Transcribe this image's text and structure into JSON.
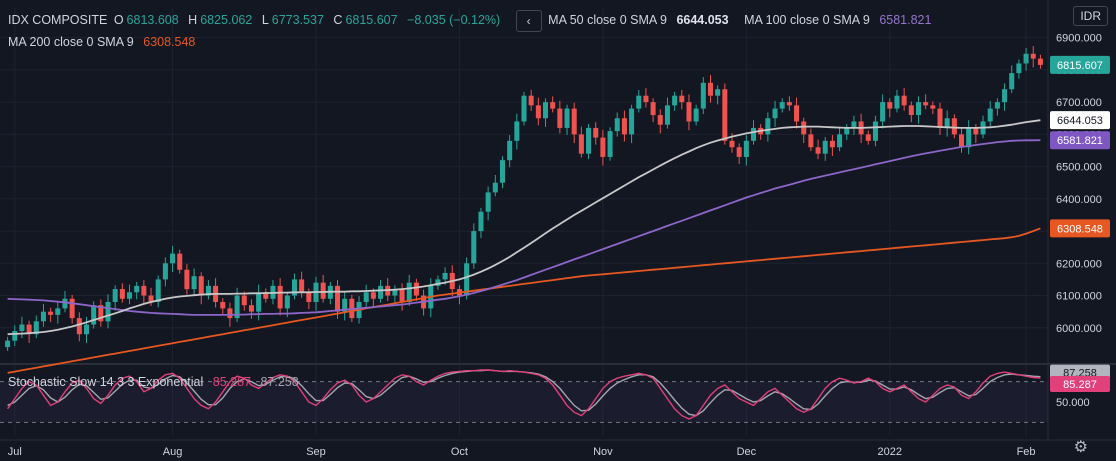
{
  "header": {
    "symbol": "IDX COMPOSITE",
    "o_label": "O",
    "o_value": "6813.608",
    "h_label": "H",
    "h_value": "6825.062",
    "l_label": "L",
    "l_value": "6773.537",
    "c_label": "C",
    "c_value": "6815.607",
    "change": "−8.035 (−0.12%)",
    "collapse_icon": "chevron-left-icon",
    "ma50_label": "MA 50 close 0 SMA 9",
    "ma50_value": "6644.053",
    "ma100_label": "MA 100 close 0 SMA 9",
    "ma100_value": "6581.821",
    "ma200_label": "MA 200 close 0 SMA 9",
    "ma200_value": "6308.548",
    "currency": "IDR"
  },
  "stoch_header": {
    "label": "Stochastic Slow 14 3 3 Exponential",
    "k_value": "85.287",
    "d_value": "87.258"
  },
  "colors": {
    "background": "#131722",
    "up": "#26a69a",
    "down": "#ef5350",
    "ma50": "#c8c8c8",
    "ma100": "#8e65c9",
    "ma200": "#e65722",
    "stoch_k": "#e2407a",
    "stoch_d": "#a3a6af",
    "grid": "#1e2230"
  },
  "chart_data": {
    "type": "candlestick",
    "y_ticks": [
      6000,
      6100,
      6200,
      6300,
      6400,
      6500,
      6600,
      6700,
      6800,
      6900
    ],
    "y_tick_labels": [
      "6000.000",
      "6100.000",
      "6200.000",
      "6300.000",
      "6400.000",
      "6500.000",
      "6600.000",
      "6700.000",
      "6800.000",
      "6900.000"
    ],
    "ylim": [
      5900,
      6930
    ],
    "x_tick_labels": [
      "Jul",
      "Aug",
      "Sep",
      "Oct",
      "Nov",
      "Dec",
      "2022",
      "Feb"
    ],
    "x_tick_index": [
      1,
      23,
      43,
      63,
      83,
      103,
      123,
      142
    ],
    "price_badges": [
      {
        "label": "6815.607",
        "value": 6815.607,
        "series": "price"
      },
      {
        "label": "6644.053",
        "value": 6644.053,
        "series": "ma50"
      },
      {
        "label": "6581.821",
        "value": 6581.821,
        "series": "ma100"
      },
      {
        "label": "6308.548",
        "value": 6308.548,
        "series": "ma200"
      }
    ],
    "closes": [
      5960,
      5990,
      6010,
      5980,
      6020,
      6050,
      6040,
      6060,
      6090,
      6030,
      5980,
      6010,
      6070,
      6020,
      6080,
      6120,
      6090,
      6110,
      6130,
      6100,
      6080,
      6150,
      6200,
      6230,
      6180,
      6120,
      6160,
      6100,
      6130,
      6080,
      6060,
      6030,
      6100,
      6070,
      6050,
      6110,
      6090,
      6130,
      6060,
      6100,
      6150,
      6110,
      6080,
      6140,
      6090,
      6130,
      6050,
      6090,
      6030,
      6080,
      6110,
      6090,
      6130,
      6100,
      6120,
      6080,
      6140,
      6100,
      6060,
      6130,
      6150,
      6170,
      6120,
      6100,
      6200,
      6300,
      6360,
      6420,
      6450,
      6520,
      6580,
      6640,
      6720,
      6690,
      6650,
      6700,
      6680,
      6620,
      6680,
      6600,
      6540,
      6620,
      6590,
      6530,
      6610,
      6650,
      6600,
      6680,
      6720,
      6700,
      6660,
      6630,
      6690,
      6720,
      6700,
      6640,
      6680,
      6760,
      6720,
      6740,
      6580,
      6560,
      6530,
      6580,
      6620,
      6600,
      6650,
      6680,
      6700,
      6690,
      6640,
      6600,
      6560,
      6540,
      6580,
      6560,
      6600,
      6620,
      6640,
      6600,
      6580,
      6640,
      6700,
      6680,
      6720,
      6690,
      6660,
      6700,
      6690,
      6680,
      6620,
      6650,
      6600,
      6560,
      6620,
      6600,
      6640,
      6680,
      6700,
      6740,
      6790,
      6820,
      6850,
      6835,
      6815.607
    ],
    "ma50": [
      5980,
      5981,
      5982,
      5983,
      5985,
      5987,
      5990,
      5994,
      5999,
      6004,
      6010,
      6017,
      6024,
      6031,
      6038,
      6045,
      6052,
      6060,
      6067,
      6074,
      6080,
      6085,
      6090,
      6094,
      6097,
      6099,
      6101,
      6103,
      6104,
      6105,
      6105,
      6105,
      6106,
      6106,
      6107,
      6107,
      6108,
      6108,
      6109,
      6109,
      6110,
      6110,
      6110,
      6111,
      6111,
      6112,
      6112,
      6112,
      6113,
      6113,
      6114,
      6115,
      6116,
      6117,
      6118,
      6120,
      6122,
      6125,
      6128,
      6132,
      6136,
      6140,
      6145,
      6150,
      6157,
      6165,
      6174,
      6184,
      6195,
      6207,
      6220,
      6234,
      6248,
      6263,
      6278,
      6293,
      6308,
      6322,
      6336,
      6350,
      6363,
      6376,
      6389,
      6402,
      6415,
      6428,
      6441,
      6454,
      6467,
      6479,
      6491,
      6503,
      6515,
      6526,
      6537,
      6547,
      6557,
      6566,
      6574,
      6581,
      6587,
      6593,
      6598,
      6603,
      6607,
      6611,
      6614,
      6617,
      6620,
      6622,
      6623,
      6624,
      6624,
      6624,
      6623,
      6622,
      6621,
      6620,
      6620,
      6620,
      6621,
      6622,
      6623,
      6624,
      6625,
      6626,
      6626,
      6626,
      6625,
      6624,
      6623,
      6622,
      6621,
      6620,
      6620,
      6620,
      6621,
      6622,
      6624,
      6627,
      6630,
      6634,
      6638,
      6641,
      6644.053
    ],
    "ma100": [
      6090,
      6089,
      6088,
      6087,
      6086,
      6085,
      6083,
      6081,
      6079,
      6076,
      6073,
      6070,
      6067,
      6064,
      6061,
      6058,
      6055,
      6052,
      6050,
      6048,
      6046,
      6045,
      6044,
      6043,
      6042,
      6041,
      6040,
      6040,
      6040,
      6040,
      6040,
      6040,
      6041,
      6041,
      6042,
      6042,
      6043,
      6043,
      6044,
      6044,
      6045,
      6046,
      6047,
      6048,
      6050,
      6052,
      6054,
      6056,
      6058,
      6060,
      6062,
      6064,
      6066,
      6068,
      6070,
      6072,
      6075,
      6078,
      6081,
      6084,
      6087,
      6090,
      6094,
      6098,
      6103,
      6108,
      6114,
      6120,
      6127,
      6134,
      6141,
      6148,
      6156,
      6164,
      6172,
      6180,
      6188,
      6196,
      6204,
      6212,
      6220,
      6228,
      6236,
      6244,
      6252,
      6260,
      6268,
      6276,
      6284,
      6292,
      6300,
      6308,
      6316,
      6324,
      6332,
      6340,
      6348,
      6356,
      6364,
      6372,
      6380,
      6388,
      6396,
      6404,
      6411,
      6418,
      6425,
      6432,
      6438,
      6444,
      6450,
      6456,
      6462,
      6467,
      6472,
      6477,
      6482,
      6487,
      6492,
      6497,
      6502,
      6507,
      6512,
      6517,
      6522,
      6527,
      6532,
      6537,
      6541,
      6545,
      6549,
      6553,
      6557,
      6561,
      6564,
      6567,
      6570,
      6573,
      6576,
      6578,
      6580,
      6581,
      6581.5,
      6581.7,
      6581.821
    ],
    "ma200": [
      5860,
      5864,
      5868,
      5872,
      5876,
      5880,
      5884,
      5888,
      5892,
      5896,
      5900,
      5904,
      5908,
      5912,
      5916,
      5920,
      5924,
      5928,
      5932,
      5936,
      5940,
      5944,
      5948,
      5952,
      5956,
      5960,
      5964,
      5968,
      5972,
      5976,
      5980,
      5984,
      5988,
      5992,
      5996,
      6000,
      6004,
      6008,
      6012,
      6016,
      6020,
      6024,
      6028,
      6032,
      6036,
      6040,
      6044,
      6048,
      6052,
      6056,
      6060,
      6064,
      6068,
      6072,
      6076,
      6080,
      6084,
      6088,
      6092,
      6096,
      6100,
      6103,
      6106,
      6109,
      6112,
      6115,
      6118,
      6121,
      6124,
      6127,
      6130,
      6133,
      6136,
      6139,
      6142,
      6145,
      6148,
      6151,
      6154,
      6157,
      6160,
      6162,
      6164,
      6166,
      6168,
      6170,
      6172,
      6174,
      6176,
      6178,
      6180,
      6182,
      6184,
      6186,
      6188,
      6190,
      6192,
      6194,
      6196,
      6198,
      6200,
      6202,
      6204,
      6206,
      6208,
      6210,
      6212,
      6214,
      6216,
      6218,
      6220,
      6222,
      6224,
      6226,
      6228,
      6230,
      6232,
      6234,
      6236,
      6238,
      6240,
      6242,
      6244,
      6246,
      6248,
      6250,
      6252,
      6254,
      6256,
      6258,
      6260,
      6262,
      6264,
      6266,
      6268,
      6270,
      6272,
      6274,
      6276,
      6278,
      6281,
      6285,
      6292,
      6300,
      6308.548
    ],
    "stoch_ticks": [
      50
    ],
    "stoch_tick_labels": [
      "50.000"
    ],
    "stoch_levels": [
      80,
      20
    ],
    "stoch_badges": [
      {
        "label": "87.258",
        "value": 87.258,
        "series": "stoch_d"
      },
      {
        "label": "85.287",
        "value": 85.287,
        "series": "stoch_k"
      }
    ],
    "stoch_k": [
      40,
      55,
      70,
      80,
      75,
      60,
      45,
      50,
      65,
      78,
      82,
      70,
      55,
      48,
      60,
      75,
      85,
      88,
      80,
      65,
      70,
      82,
      90,
      92,
      85,
      70,
      55,
      45,
      40,
      50,
      65,
      80,
      88,
      85,
      75,
      70,
      78,
      86,
      90,
      88,
      80,
      65,
      50,
      45,
      55,
      68,
      78,
      82,
      75,
      60,
      50,
      55,
      65,
      75,
      85,
      90,
      88,
      80,
      75,
      82,
      88,
      92,
      94,
      95,
      96,
      96,
      97,
      97,
      96,
      95,
      96,
      95,
      94,
      92,
      90,
      85,
      75,
      60,
      45,
      35,
      30,
      40,
      55,
      70,
      80,
      85,
      88,
      90,
      92,
      90,
      85,
      70,
      55,
      40,
      30,
      25,
      30,
      45,
      60,
      70,
      75,
      65,
      55,
      50,
      45,
      55,
      65,
      70,
      60,
      50,
      40,
      35,
      40,
      55,
      70,
      80,
      85,
      82,
      78,
      80,
      85,
      80,
      70,
      65,
      70,
      75,
      65,
      55,
      50,
      60,
      70,
      75,
      72,
      60,
      55,
      65,
      78,
      88,
      92,
      94,
      92,
      90,
      88,
      86,
      85.287
    ],
    "stoch_d": [
      45,
      50,
      60,
      70,
      74,
      68,
      56,
      50,
      57,
      68,
      76,
      74,
      64,
      54,
      56,
      66,
      76,
      82,
      82,
      72,
      70,
      76,
      84,
      89,
      87,
      78,
      66,
      54,
      46,
      46,
      56,
      70,
      80,
      84,
      80,
      74,
      76,
      82,
      87,
      88,
      84,
      74,
      62,
      52,
      52,
      61,
      71,
      78,
      77,
      68,
      58,
      55,
      60,
      69,
      78,
      86,
      88,
      84,
      79,
      80,
      85,
      89,
      92,
      94,
      95,
      96,
      96,
      97,
      96,
      95,
      95,
      95,
      94,
      93,
      91,
      87,
      80,
      70,
      57,
      45,
      37,
      38,
      47,
      59,
      70,
      78,
      83,
      87,
      90,
      90,
      87,
      78,
      66,
      53,
      41,
      32,
      30,
      37,
      49,
      60,
      68,
      67,
      61,
      55,
      50,
      52,
      59,
      65,
      62,
      55,
      47,
      40,
      39,
      47,
      59,
      70,
      78,
      80,
      79,
      79,
      82,
      81,
      75,
      69,
      69,
      72,
      68,
      61,
      55,
      57,
      64,
      70,
      71,
      65,
      59,
      61,
      70,
      80,
      86,
      90,
      91,
      90,
      89,
      88,
      87.258
    ]
  }
}
